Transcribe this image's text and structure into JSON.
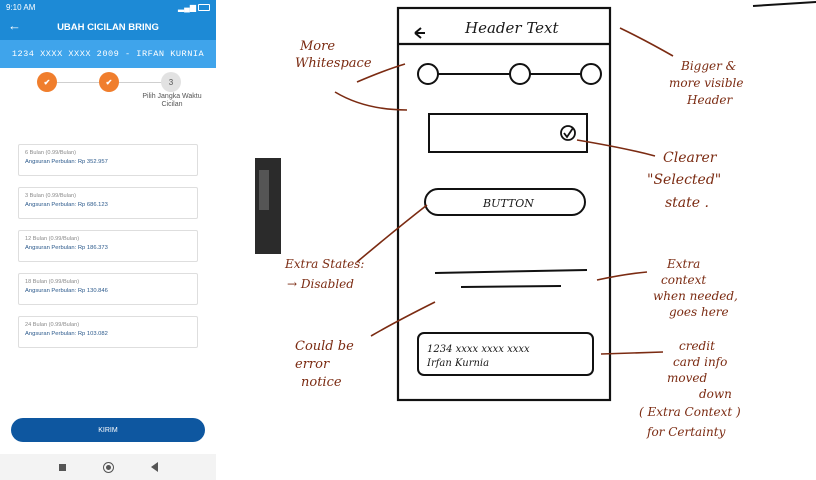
{
  "phone": {
    "status": {
      "time": "9:10 AM"
    },
    "appbar": {
      "back_icon": "←",
      "title": "UBAH CICILAN BRING"
    },
    "card_number": "1234 XXXX XXXX 2009 - IRFAN KURNIA",
    "steps": [
      {
        "state": "done",
        "symbol": "✔"
      },
      {
        "state": "done",
        "symbol": "✔"
      },
      {
        "state": "todo",
        "symbol": "3"
      }
    ],
    "step3_label": "Pilih Jangka Waktu Cicilan",
    "options": [
      {
        "term": "6 Bulan (0.99/Bulan)",
        "installment": "Angsuran Perbulan: Rp 352.957"
      },
      {
        "term": "3 Bulan (0.99/Bulan)",
        "installment": "Angsuran Perbulan: Rp 686.123"
      },
      {
        "term": "12 Bulan (0.99/Bulan)",
        "installment": "Angsuran Perbulan: Rp 186.373"
      },
      {
        "term": "18 Bulan (0.99/Bulan)",
        "installment": "Angsuran Perbulan: Rp 130.846"
      },
      {
        "term": "24 Bulan (0.99/Bulan)",
        "installment": "Angsuran Perbulan: Rp 103.082"
      }
    ],
    "submit_label": "KIRIM"
  },
  "sketch": {
    "header_text": "Header Text",
    "button_text": "BUTTON",
    "card_line1": "1234 xxxx xxxx xxxx",
    "card_line2": "Irfan Kurnia",
    "notes": {
      "more_whitespace": [
        "More",
        "Whitespace"
      ],
      "bigger_header": [
        "Bigger &",
        "more visible",
        "Header"
      ],
      "clearer_selected": [
        "Clearer",
        "\"Selected\"",
        "state ."
      ],
      "extra_states": [
        "Extra States:",
        "→ Disabled"
      ],
      "extra_context": [
        "Extra",
        "context",
        "when needed,",
        "goes here"
      ],
      "could_be_error": [
        "Could be",
        "error",
        "notice"
      ],
      "credit_card_info": [
        "credit",
        "card info",
        "moved",
        "down",
        "( Extra Context )",
        "for Certainty"
      ]
    }
  }
}
